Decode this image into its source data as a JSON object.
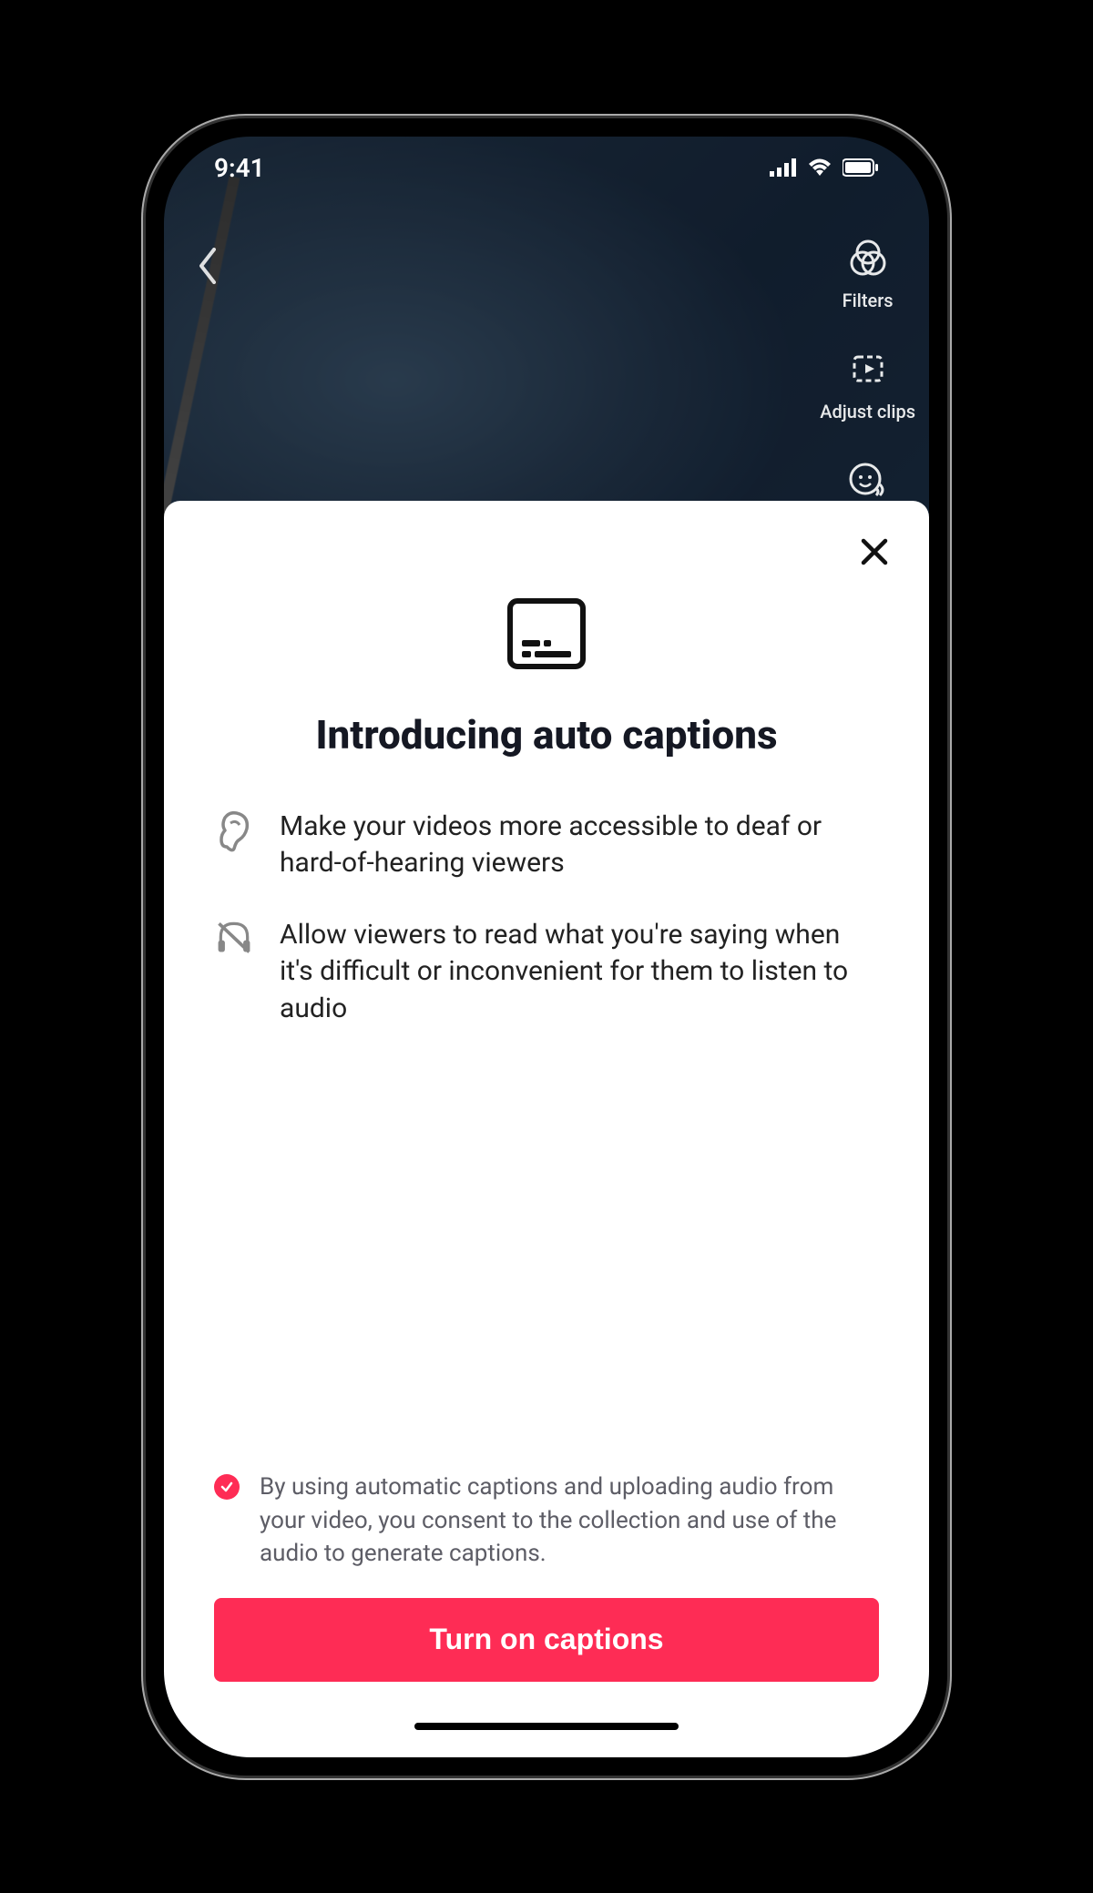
{
  "status": {
    "time": "9:41"
  },
  "background": {
    "tools": {
      "filters_label": "Filters",
      "adjust_label": "Adjust clips"
    }
  },
  "sheet": {
    "title": "Introducing auto captions",
    "benefit1": "Make your videos more accessible to deaf or hard-of-hearing viewers",
    "benefit2": "Allow viewers to read what you're saying when it's difficult or inconvenient for them to listen to audio",
    "consent": "By using automatic captions and uploading audio from your video, you consent to the collection and use of the audio to generate captions.",
    "cta_label": "Turn on captions"
  },
  "colors": {
    "accent": "#fe2c55"
  }
}
